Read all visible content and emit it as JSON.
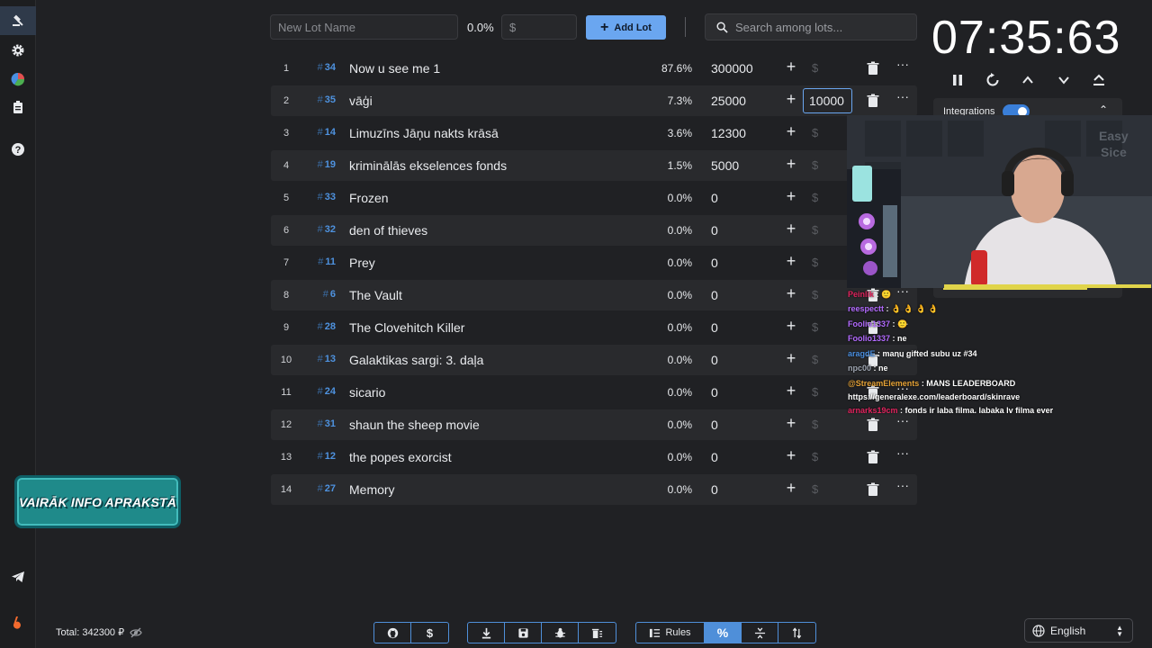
{
  "toolbar": {
    "lot_name_placeholder": "New Lot Name",
    "percent": "0.0%",
    "amount_placeholder": "$",
    "add_lot_label": "Add Lot",
    "search_placeholder": "Search among lots..."
  },
  "lots": [
    {
      "n": "1",
      "id": "34",
      "name": "Now u see me 1",
      "pct": "87.6%",
      "amount": "300000"
    },
    {
      "n": "2",
      "id": "35",
      "name": "vāģi",
      "pct": "7.3%",
      "amount": "25000",
      "add_value": "10000"
    },
    {
      "n": "3",
      "id": "14",
      "name": "Limuzīns Jāņu nakts krāsā",
      "pct": "3.6%",
      "amount": "12300"
    },
    {
      "n": "4",
      "id": "19",
      "name": "kriminālās ekselences fonds",
      "pct": "1.5%",
      "amount": "5000"
    },
    {
      "n": "5",
      "id": "33",
      "name": "Frozen",
      "pct": "0.0%",
      "amount": "0"
    },
    {
      "n": "6",
      "id": "32",
      "name": "den of thieves",
      "pct": "0.0%",
      "amount": "0"
    },
    {
      "n": "7",
      "id": "11",
      "name": "Prey",
      "pct": "0.0%",
      "amount": "0"
    },
    {
      "n": "8",
      "id": "6",
      "name": "The Vault",
      "pct": "0.0%",
      "amount": "0"
    },
    {
      "n": "9",
      "id": "28",
      "name": "The Clovehitch Killer",
      "pct": "0.0%",
      "amount": "0"
    },
    {
      "n": "10",
      "id": "13",
      "name": "Galaktikas sargi: 3. daļa",
      "pct": "0.0%",
      "amount": "0"
    },
    {
      "n": "11",
      "id": "24",
      "name": "sicario",
      "pct": "0.0%",
      "amount": "0"
    },
    {
      "n": "12",
      "id": "31",
      "name": "shaun the sheep movie",
      "pct": "0.0%",
      "amount": "0"
    },
    {
      "n": "13",
      "id": "12",
      "name": "the popes exorcist",
      "pct": "0.0%",
      "amount": "0"
    },
    {
      "n": "14",
      "id": "27",
      "name": "Memory",
      "pct": "0.0%",
      "amount": "0"
    }
  ],
  "row_icons": {
    "hash": "#",
    "plus": "+",
    "dollar": "$",
    "more": "···"
  },
  "timer": "07:35:63",
  "integrations_label": "Integrations",
  "chat": [
    {
      "user": "Peinlik",
      "text": " : 🙂",
      "color": "#e0245e"
    },
    {
      "user": "reespectt",
      "text": " : 👌 👌 👌 👌",
      "color": "#b36bff"
    },
    {
      "user": "Foolio1337",
      "text": " : 🙂",
      "color": "#b36bff"
    },
    {
      "user": "Foolio1337",
      "text": " : ne",
      "color": "#b36bff"
    },
    {
      "user": "aragdE",
      "text": " : manu gifted subu uz #34",
      "color": "#4a8fe0"
    },
    {
      "user": "npc00",
      "text": " : ne",
      "color": "#9fa6b2"
    },
    {
      "user": "@StreamElements",
      "text": " : MANS LEADERBOARD",
      "color": "#e5a236"
    },
    {
      "user": "",
      "text": "https://generalexe.com/leaderboard/skinrave",
      "color": "#ffffff"
    },
    {
      "user": "arnarks19cm",
      "text": " : fonds ir laba filma. labaka lv filma ever",
      "color": "#e0245e"
    }
  ],
  "promo_text": "VAIRĀK INFO APRAKSTĀ",
  "total": "Total: 342300 ₽",
  "bottom": {
    "rules_label": "Rules"
  },
  "language": "English",
  "colors": {
    "accent": "#6aa6f0",
    "background": "#202124",
    "row_alt": "#292a2d",
    "lot_id": "#4e92df"
  }
}
